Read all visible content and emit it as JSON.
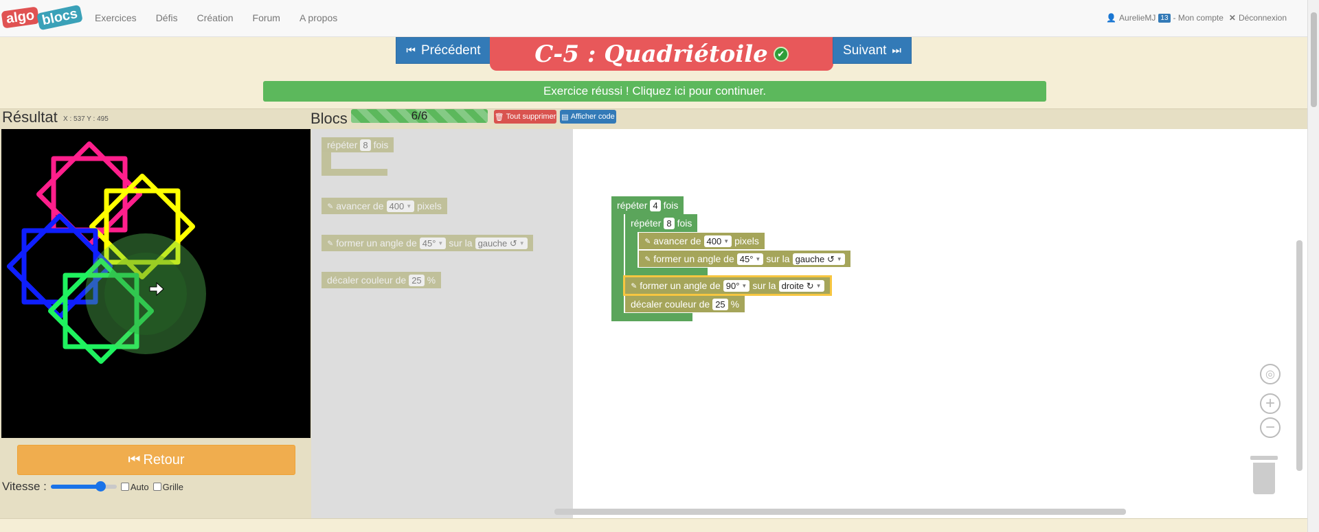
{
  "nav": {
    "logo_algo": "algo",
    "logo_blocs": "blocs",
    "menu": [
      "Exercices",
      "Défis",
      "Création",
      "Forum",
      "A propos"
    ],
    "user": "AurelieMJ",
    "user_badge": "13",
    "account": "- Mon compte",
    "logout": "Déconnexion"
  },
  "header": {
    "prev": "Précédent",
    "next": "Suivant",
    "title": "C-5 : Quadriétoile",
    "success": "Exercice réussi ! Cliquez ici pour continuer."
  },
  "result": {
    "heading": "Résultat",
    "coords": "X : 537 Y : 495",
    "retour": "Retour",
    "vitesse": "Vitesse :",
    "speed_level_percent": 75,
    "auto": "Auto",
    "grille": "Grille",
    "star_colors": [
      "#ff1f8c",
      "#ffff00",
      "#0f1fff",
      "#1ff25f"
    ]
  },
  "blocs": {
    "heading": "Blocs",
    "progress": "6/6",
    "delete_all": "Tout supprimer",
    "show_code": "Afficher code"
  },
  "toolbox": {
    "repeat": {
      "t1": "répéter",
      "val": "8",
      "t2": "fois"
    },
    "forward": {
      "t1": "avancer de",
      "val": "400",
      "t2": "pixels"
    },
    "turn": {
      "t1": "former un angle de",
      "val": "45°",
      "t2": "sur la",
      "dir": "gauche ↺"
    },
    "color": {
      "t1": "décaler couleur de",
      "val": "25",
      "t2": "%"
    }
  },
  "program": {
    "outer": {
      "t1": "répéter",
      "val": "4",
      "t2": "fois"
    },
    "inner": {
      "t1": "répéter",
      "val": "8",
      "t2": "fois"
    },
    "forward": {
      "t1": "avancer de",
      "val": "400",
      "t2": "pixels"
    },
    "turn1": {
      "t1": "former un angle de",
      "val": "45°",
      "t2": "sur la",
      "dir": "gauche ↺"
    },
    "turn2": {
      "t1": "former un angle de",
      "val": "90°",
      "t2": "sur la",
      "dir": "droite ↻"
    },
    "color": {
      "t1": "décaler couleur de",
      "val": "25",
      "t2": "%"
    }
  }
}
